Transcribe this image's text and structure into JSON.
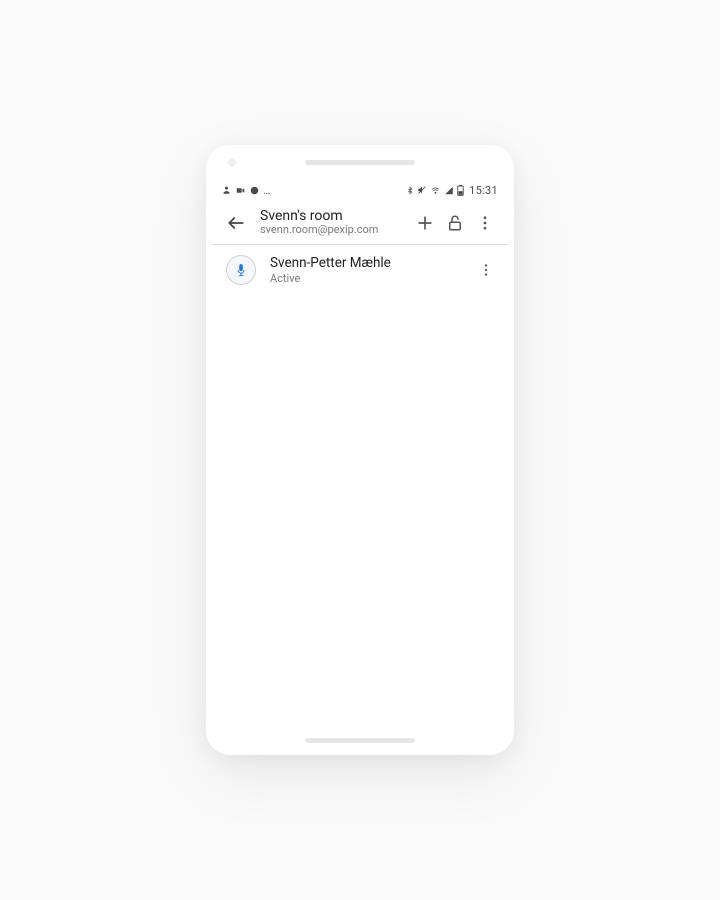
{
  "status_bar": {
    "time": "15:31"
  },
  "header": {
    "title": "Svenn's room",
    "subtitle": "svenn.room@pexip.com"
  },
  "participants": [
    {
      "name": "Svenn-Petter Mæhle",
      "status": "Active"
    }
  ]
}
